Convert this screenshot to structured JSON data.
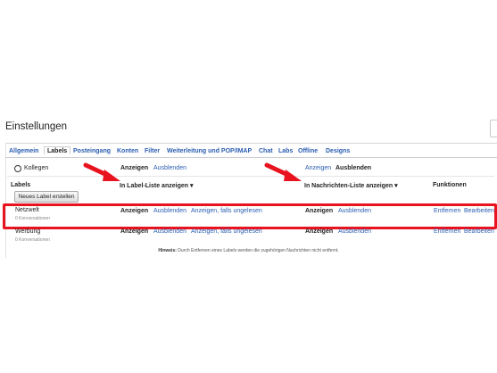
{
  "window": {
    "title": "Einstellungen"
  },
  "tabs": [
    {
      "label": "Allgemein"
    },
    {
      "label": "Labels"
    },
    {
      "label": "Posteingang"
    },
    {
      "label": "Konten"
    },
    {
      "label": "Filter"
    },
    {
      "label": "Weiterleitung und POP/IMAP"
    },
    {
      "label": "Chat"
    },
    {
      "label": "Labs"
    },
    {
      "label": "Offline"
    },
    {
      "label": "Designs"
    }
  ],
  "system_row": {
    "label": "Kollegen",
    "list_show": "Anzeigen",
    "list_hide": "Ausblenden",
    "msg_show": "Anzeigen",
    "msg_hide": "Ausblenden"
  },
  "header": {
    "labels": "Labels",
    "in_label_list": "In Label-Liste anzeigen ▾",
    "in_message_list": "In Nachrichten-Liste anzeigen ▾",
    "functions": "Funktionen"
  },
  "new_label_button": "Neues Label erstellen",
  "labels": [
    {
      "name": "Netzwelt",
      "count": "0 Konversationen",
      "show": "Anzeigen",
      "hide": "Ausblenden",
      "show_unread": "Anzeigen, falls ungelesen",
      "msg_show": "Anzeigen",
      "msg_hide": "Ausblenden",
      "remove": "Entfernen",
      "edit": "Bearbeiten"
    },
    {
      "name": "Werbung",
      "count": "0 Konversationen",
      "show": "Anzeigen",
      "hide": "Ausblenden",
      "show_unread": "Anzeigen, falls ungelesen",
      "msg_show": "Anzeigen",
      "msg_hide": "Ausblenden",
      "remove": "Entfernen",
      "edit": "Bearbeiten"
    }
  ],
  "note": {
    "prefix": "Hinweis:",
    "text": "Durch Entfernen eines Labels werden die zugehörigen Nachrichten nicht entfernt."
  },
  "colors": {
    "link": "#2a5db0",
    "highlight": "#e8131f",
    "arrow": "#e8131f"
  },
  "icons": {
    "arrow_label_list": "red-arrow-icon",
    "arrow_message_list": "red-arrow-icon"
  }
}
